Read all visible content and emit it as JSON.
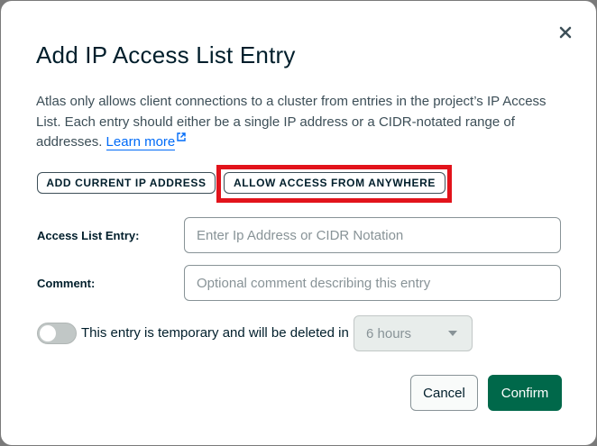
{
  "dialog": {
    "title": "Add IP Access List Entry",
    "description": "Atlas only allows client connections to a cluster from entries in the project’s IP Access List. Each entry should either be a single IP address or a CIDR-notated range of addresses.",
    "learn_more": "Learn more",
    "close_icon": "close-icon"
  },
  "quick_actions": {
    "add_current_ip": "ADD CURRENT IP ADDRESS",
    "allow_anywhere": "ALLOW ACCESS FROM ANYWHERE",
    "highlight_color": "#e2131b"
  },
  "form": {
    "entry_label": "Access List Entry:",
    "entry_value": "",
    "entry_placeholder": "Enter Ip Address or CIDR Notation",
    "comment_label": "Comment:",
    "comment_value": "",
    "comment_placeholder": "Optional comment describing this entry",
    "temporary_toggle_on": false,
    "temporary_text": "This entry is temporary and will be deleted in",
    "duration_selected": "6 hours"
  },
  "footer": {
    "cancel_label": "Cancel",
    "confirm_label": "Confirm"
  },
  "colors": {
    "primary": "#00684a",
    "link": "#016bf8",
    "text": "#001e2b"
  }
}
